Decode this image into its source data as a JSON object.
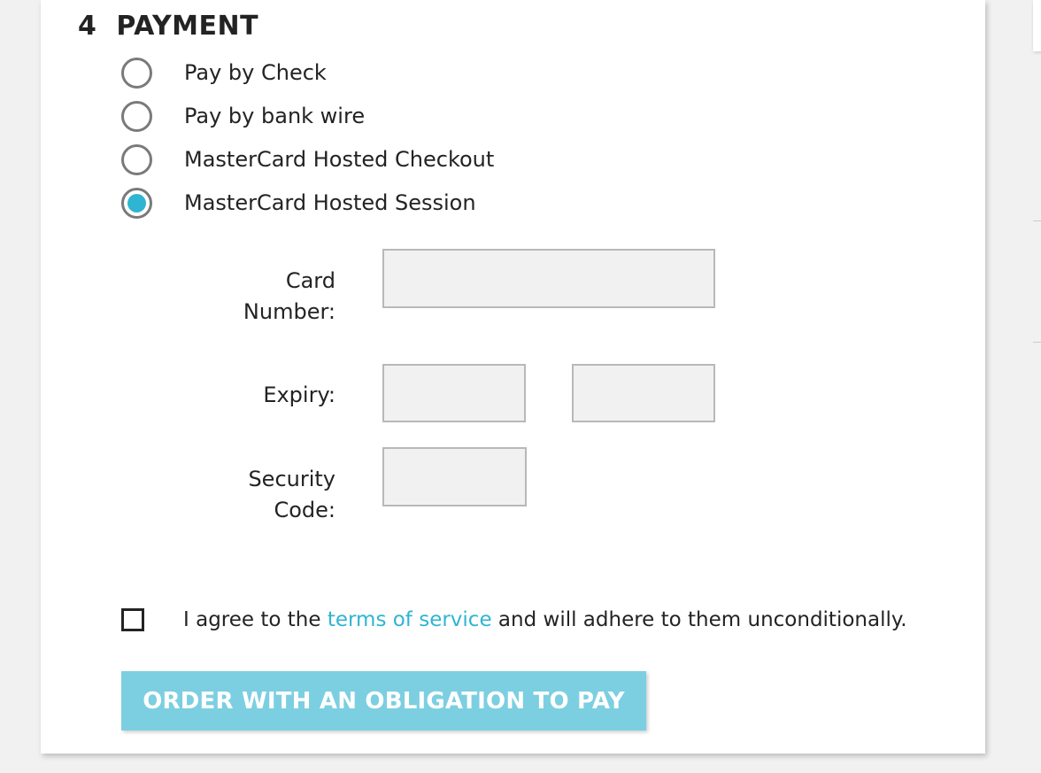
{
  "section": {
    "number": "4",
    "title": "PAYMENT"
  },
  "payment_options": [
    {
      "label": "Pay by Check",
      "selected": false
    },
    {
      "label": "Pay by bank wire",
      "selected": false
    },
    {
      "label": "MasterCard Hosted Checkout",
      "selected": false
    },
    {
      "label": "MasterCard Hosted Session",
      "selected": true
    }
  ],
  "hosted_session_form": {
    "card_number_label_line1": "Card",
    "card_number_label_line2": "Number:",
    "card_number_value": "",
    "expiry_label": "Expiry:",
    "expiry_month_value": "",
    "expiry_year_value": "",
    "security_code_label_line1": "Security",
    "security_code_label_line2": "Code:",
    "security_code_value": ""
  },
  "terms": {
    "prefix": "I agree to the ",
    "link_text": "terms of service",
    "suffix": " and will adhere to them unconditionally.",
    "checked": false
  },
  "order_button": {
    "label": "ORDER WITH AN OBLIGATION TO PAY"
  },
  "colors": {
    "accent": "#2fb5d2",
    "button_bg": "#7ccfe1",
    "field_bg": "#f1f1f1",
    "page_bg": "#f1f1f1"
  }
}
